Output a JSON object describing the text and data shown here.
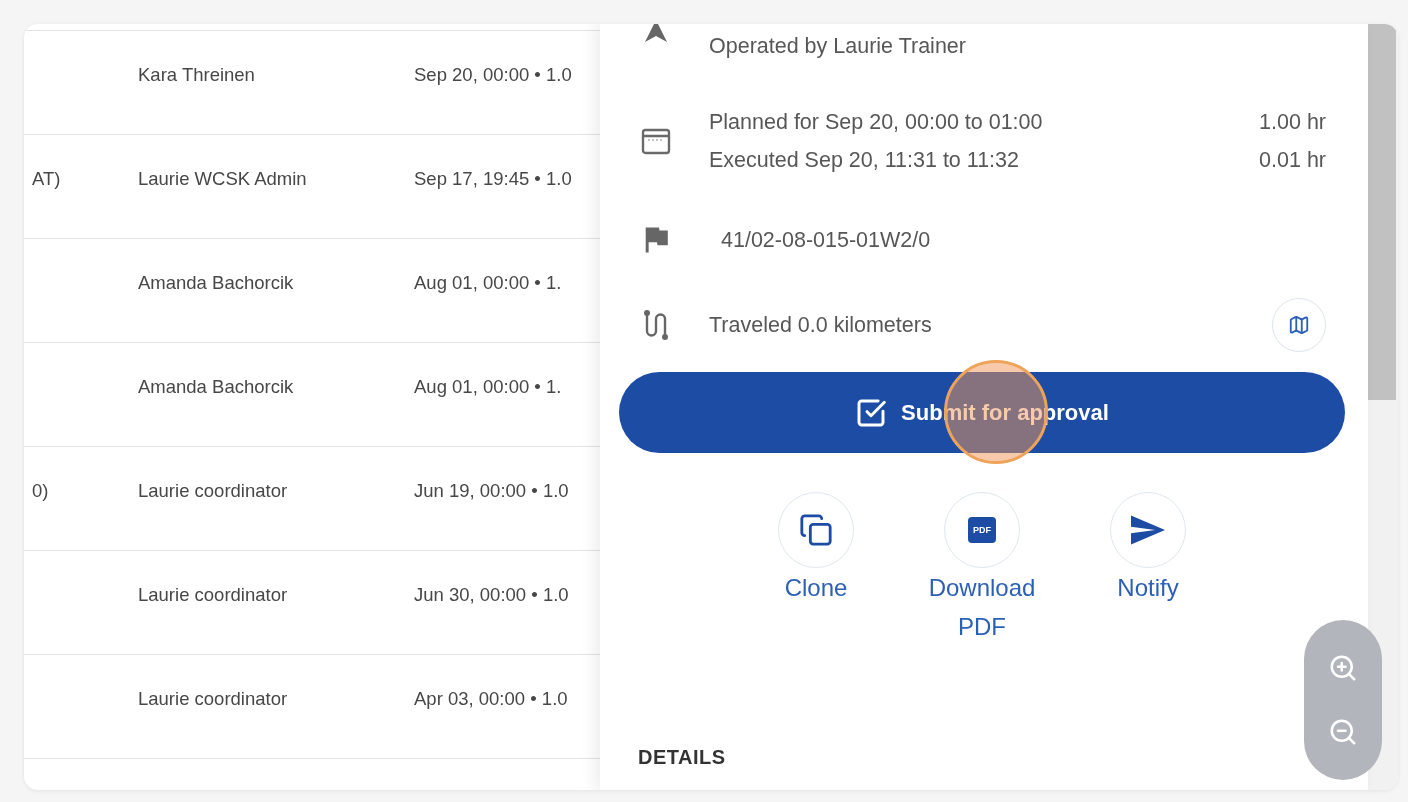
{
  "table": {
    "rows": [
      {
        "column_2": "Kara Threinen",
        "column_3": "Sep 20, 00:00 • 1.0"
      },
      {
        "column_1": "AT)",
        "column_2": "Laurie WCSK Admin",
        "column_3": "Sep 17, 19:45 • 1.0"
      },
      {
        "column_2": "Amanda Bachorcik",
        "column_3": "Aug 01, 00:00 • 1."
      },
      {
        "column_2": "Amanda Bachorcik",
        "column_3": "Aug 01, 00:00 • 1."
      },
      {
        "column_1": "0)",
        "column_2": "Laurie coordinator",
        "column_3": "Jun 19, 00:00 • 1.0"
      },
      {
        "column_2": "Laurie coordinator",
        "column_3": "Jun 30, 00:00 • 1.0"
      },
      {
        "column_2": "Laurie coordinator",
        "column_3": "Apr 03, 00:00 • 1.0"
      }
    ]
  },
  "drawer": {
    "operator": "Operated by Laurie Trainer",
    "schedule": [
      {
        "label": "Planned for Sep 20, 00:00 to 01:00",
        "duration": "1.00 hr"
      },
      {
        "label": "Executed Sep 20, 11:31 to 11:32",
        "duration": "0.01 hr"
      }
    ],
    "location": "41/02-08-015-01W2/0",
    "distance": "Traveled 0.0 kilometers",
    "primary_action": "Submit for approval",
    "actions": [
      {
        "kind": "clone",
        "label": "Clone"
      },
      {
        "kind": "pdf",
        "label": "Download PDF",
        "badge": "PDF"
      },
      {
        "kind": "notify",
        "label": "Notify"
      }
    ],
    "section_title": "DETAILS"
  }
}
